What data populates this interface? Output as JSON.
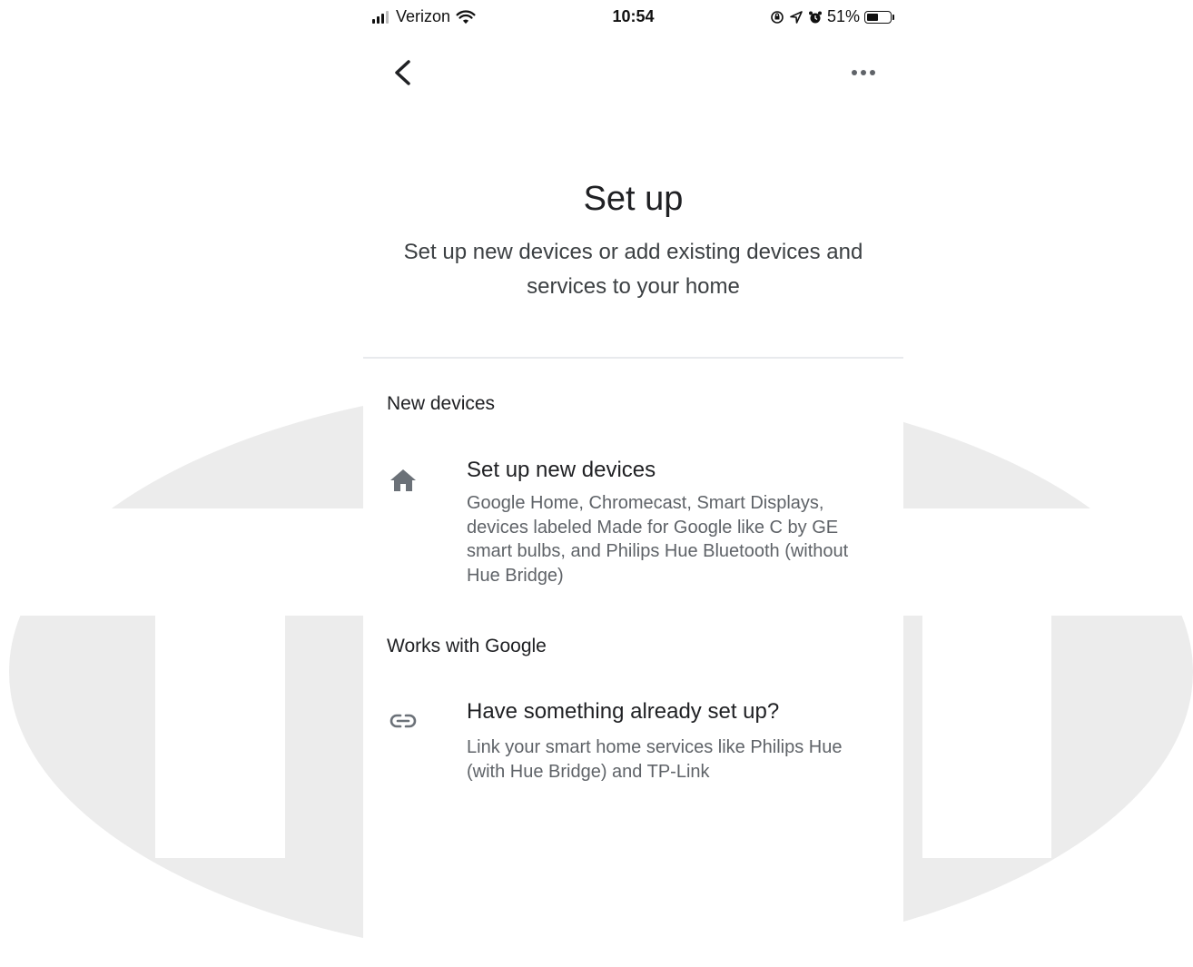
{
  "status_bar": {
    "carrier": "Verizon",
    "time": "10:54",
    "battery": "51%",
    "battery_level": 0.51
  },
  "icons": {
    "back": "back-arrow-icon",
    "more": "more-options-icon",
    "home": "home-icon",
    "link": "link-icon"
  },
  "colors": {
    "text_primary": "#202124",
    "text_secondary": "#5f6368",
    "icon_gray": "#6b7178",
    "watermark_gray": "#ececec"
  },
  "page": {
    "title": "Set up",
    "subtitle": "Set up new devices or add existing devices and services to your home"
  },
  "sections": {
    "new_devices": {
      "header": "New devices",
      "title": "Set up new devices",
      "description": "Google Home, Chromecast, Smart Displays, devices labeled Made for Google like C by GE smart bulbs, and Philips Hue Bluetooth (without Hue Bridge)"
    },
    "works_with_google": {
      "header": "Works with Google",
      "title": "Have something already set up?",
      "description": "Link your smart home services like Philips Hue (with Hue Bridge) and TP-Link"
    }
  }
}
